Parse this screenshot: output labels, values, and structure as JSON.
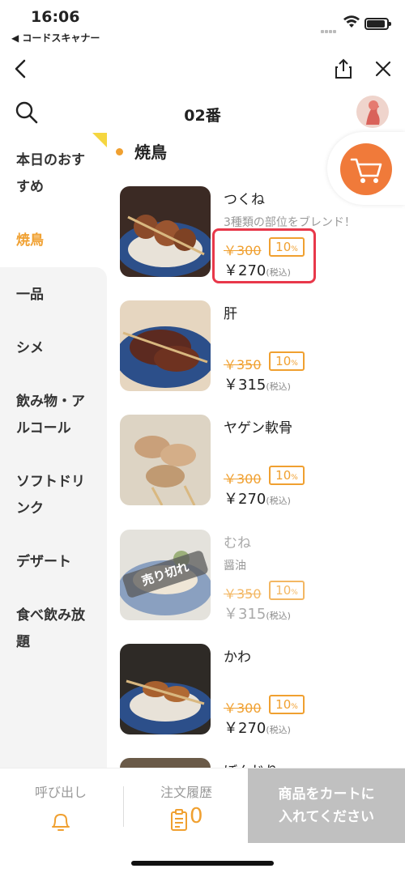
{
  "status_bar": {
    "time": "16:06",
    "back_app": "◀ コードスキャナー"
  },
  "header": {
    "table_no": "02番"
  },
  "sidebar": {
    "items": [
      {
        "label": "本日のおすすめ",
        "active": false
      },
      {
        "label": "焼鳥",
        "active": true
      },
      {
        "label": "一品",
        "active": false
      },
      {
        "label": "シメ",
        "active": false
      },
      {
        "label": "飲み物・アルコール",
        "active": false
      },
      {
        "label": "ソフトドリンク",
        "active": false
      },
      {
        "label": "デザート",
        "active": false
      },
      {
        "label": "食べ飲み放題",
        "active": false
      }
    ]
  },
  "section": {
    "title": "焼鳥"
  },
  "menu": {
    "items": [
      {
        "name": "つくね",
        "desc": "3種類の部位をブレンド！",
        "original_price": "￥300",
        "discount": "10",
        "price": "￥270",
        "tax_note": "(税込)",
        "sold_out": false
      },
      {
        "name": "肝",
        "desc": "",
        "original_price": "￥350",
        "discount": "10",
        "price": "￥315",
        "tax_note": "(税込)",
        "sold_out": false
      },
      {
        "name": "ヤゲン軟骨",
        "desc": "",
        "original_price": "￥300",
        "discount": "10",
        "price": "￥270",
        "tax_note": "(税込)",
        "sold_out": false
      },
      {
        "name": "むね",
        "desc": "醤油",
        "original_price": "￥350",
        "discount": "10",
        "price": "￥315",
        "tax_note": "(税込)",
        "sold_out": true,
        "sold_out_label": "売り切れ"
      },
      {
        "name": "かわ",
        "desc": "",
        "original_price": "￥300",
        "discount": "10",
        "price": "￥270",
        "tax_note": "(税込)",
        "sold_out": false
      },
      {
        "name": "ぼんじり",
        "desc": "",
        "original_price": "",
        "discount": "",
        "price": "",
        "tax_note": "",
        "sold_out": false
      }
    ]
  },
  "bottom_bar": {
    "call_label": "呼び出し",
    "history_label": "注文履歴",
    "history_count": "0",
    "add_cart_label_line1": "商品をカートに",
    "add_cart_label_line2": "入れてください"
  },
  "colors": {
    "accent": "#f0a030",
    "cart": "#f07a3a",
    "highlight": "#e8384a",
    "disabled": "#c0c0c0"
  }
}
